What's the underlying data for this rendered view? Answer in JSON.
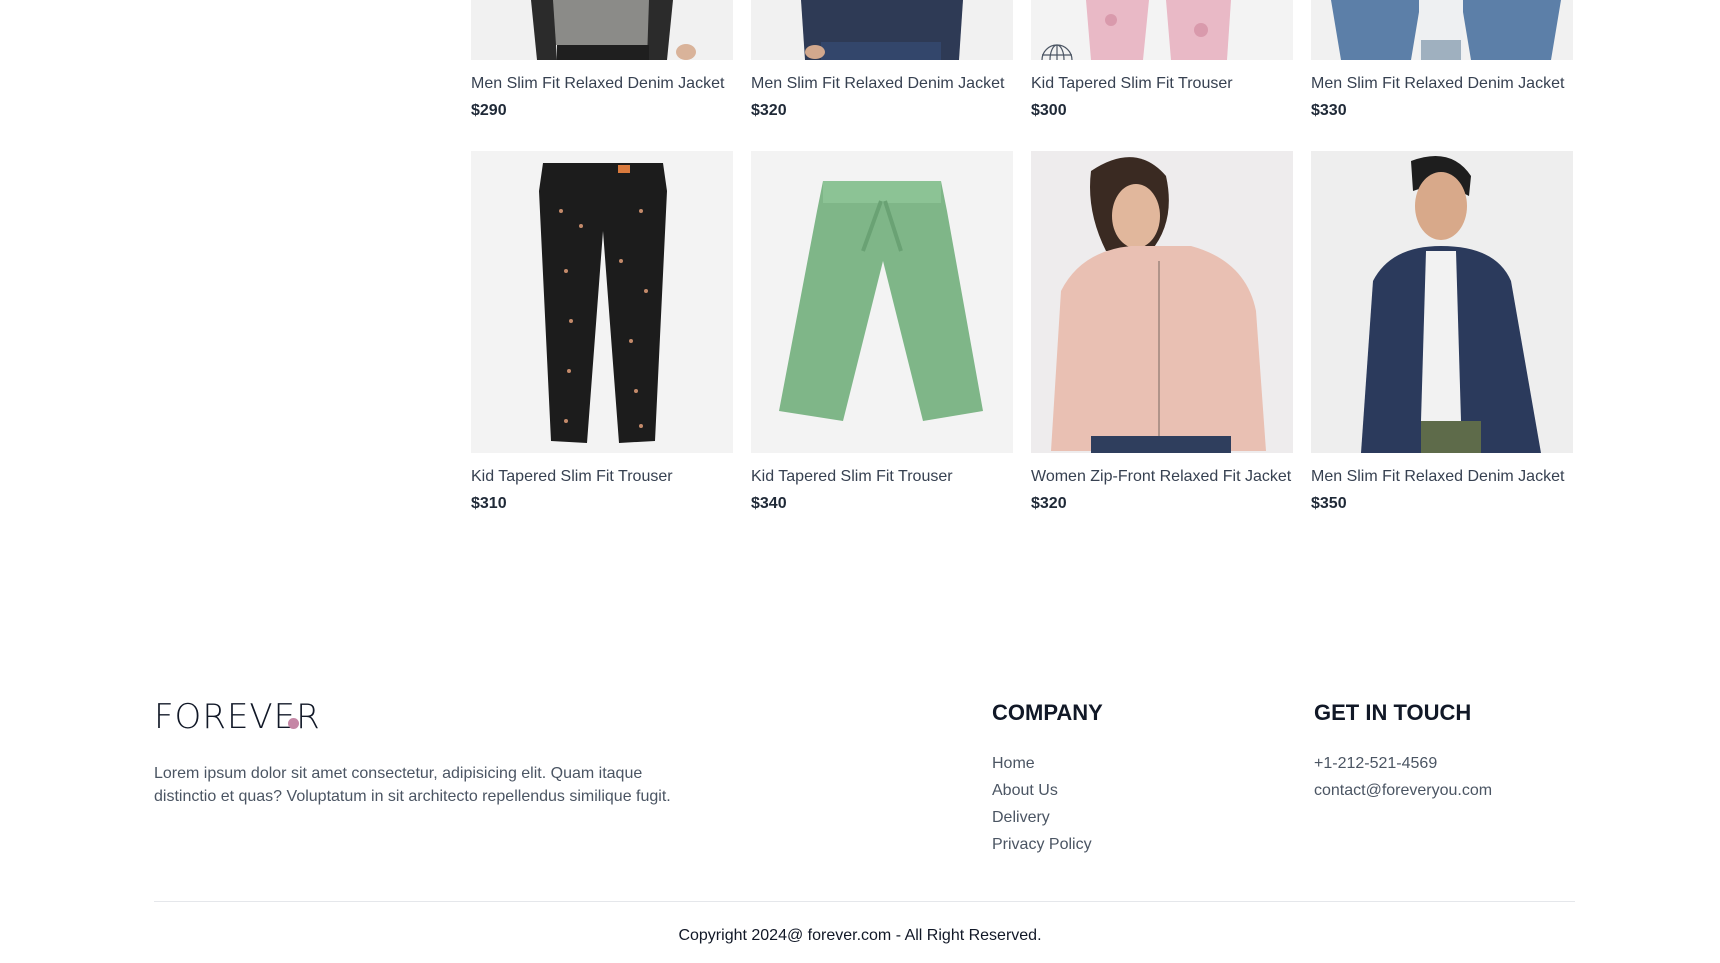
{
  "products_row1": [
    {
      "title": "Men Slim Fit Relaxed Denim Jacket",
      "price": "$290"
    },
    {
      "title": "Men Slim Fit Relaxed Denim Jacket",
      "price": "$320"
    },
    {
      "title": "Kid Tapered Slim Fit Trouser",
      "price": "$300"
    },
    {
      "title": "Men Slim Fit Relaxed Denim Jacket",
      "price": "$330"
    }
  ],
  "products_row2": [
    {
      "title": "Kid Tapered Slim Fit Trouser",
      "price": "$310"
    },
    {
      "title": "Kid Tapered Slim Fit Trouser",
      "price": "$340"
    },
    {
      "title": "Women Zip-Front Relaxed Fit Jacket",
      "price": "$320"
    },
    {
      "title": "Men Slim Fit Relaxed Denim Jacket",
      "price": "$350"
    }
  ],
  "footer": {
    "logo": "FOREVER",
    "accent_color": "#c586a5",
    "about": "Lorem ipsum dolor sit amet consectetur, adipisicing elit. Quam itaque distinctio et quas? Voluptatum in sit architecto repellendus similique fugit.",
    "company_heading": "COMPANY",
    "company_links": [
      "Home",
      "About Us",
      "Delivery",
      "Privacy Policy"
    ],
    "contact_heading": "GET IN TOUCH",
    "contact_items": [
      "+1-212-521-4569",
      "contact@foreveryou.com"
    ],
    "copyright": "Copyright 2024@ forever.com - All Right Reserved."
  }
}
